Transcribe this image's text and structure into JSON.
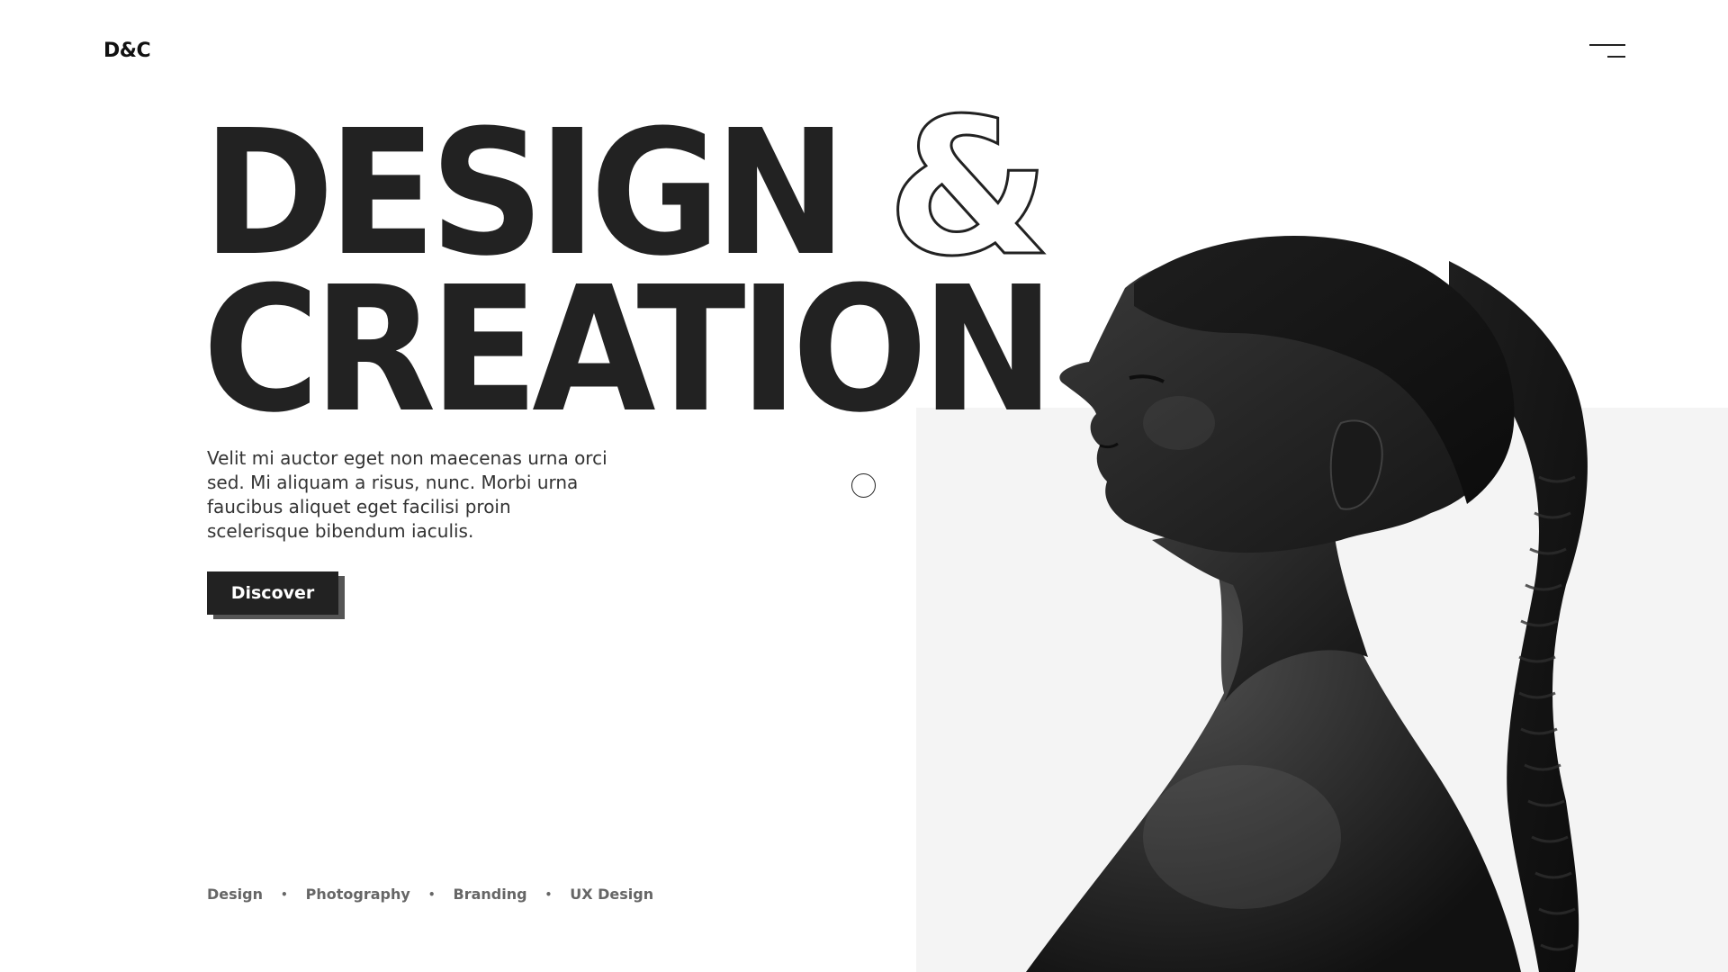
{
  "header": {
    "logo": "D&C",
    "menu_icon": "hamburger-menu-icon"
  },
  "hero": {
    "title_line_1": "DESIGN",
    "title_ampersand": "&",
    "title_line_2": "CREATION",
    "description": "Velit mi auctor eget non maecenas urna orci sed. Mi aliquam a risus, nunc. Morbi urna faucibus aliquet eget facilisi proin scelerisque bibendum iaculis.",
    "cta_label": "Discover"
  },
  "tags": {
    "items": [
      "Design",
      "Photography",
      "Branding",
      "UX Design"
    ],
    "separator": "•"
  },
  "colors": {
    "text": "#222222",
    "panel": "#f4f4f4",
    "background": "#ffffff",
    "muted": "#666666"
  },
  "image": {
    "subject": "black-and-white profile portrait of woman with long braided ponytail"
  }
}
